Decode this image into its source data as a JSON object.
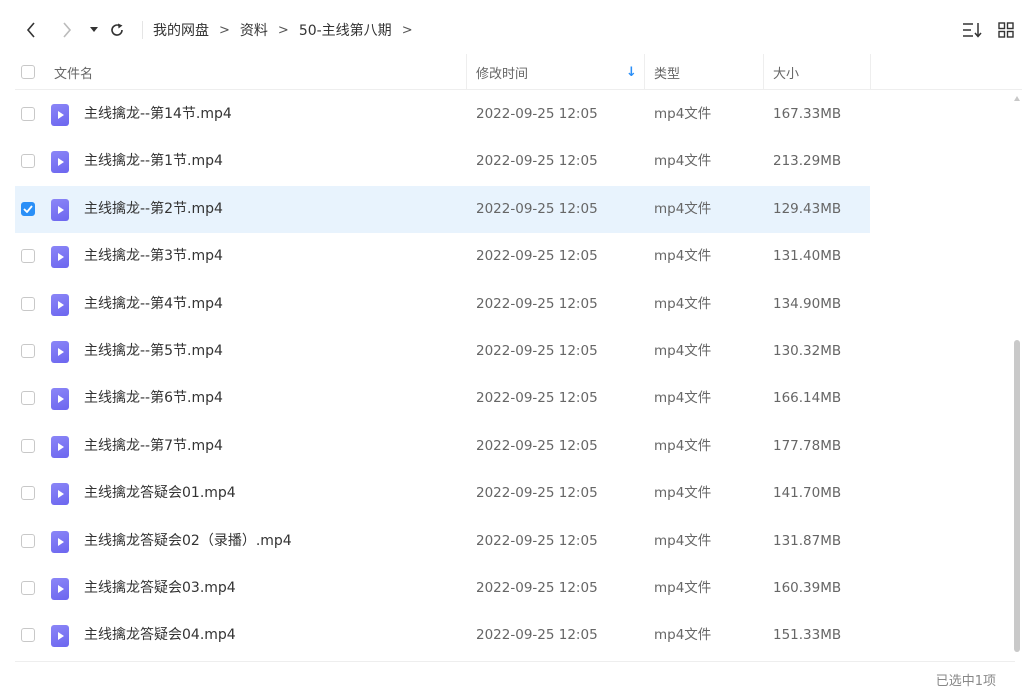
{
  "toolbar": {
    "back_icon": "chevron-left-icon",
    "forward_icon": "chevron-right-icon",
    "history_icon": "dropdown-triangle-icon",
    "refresh_icon": "refresh-icon",
    "sort_icon": "sort-list-icon",
    "grid_icon": "grid-view-icon"
  },
  "breadcrumb": {
    "items": [
      "我的网盘",
      "资料",
      "50-主线第八期"
    ],
    "separator": ">"
  },
  "header": {
    "name": "文件名",
    "modified": "修改时间",
    "type": "类型",
    "size": "大小",
    "sort_indicator": "↓"
  },
  "files": [
    {
      "name": "主线擒龙--第14节.mp4",
      "modified": "2022-09-25 12:05",
      "type": "mp4文件",
      "size": "167.33MB",
      "selected": false
    },
    {
      "name": "主线擒龙--第1节.mp4",
      "modified": "2022-09-25 12:05",
      "type": "mp4文件",
      "size": "213.29MB",
      "selected": false
    },
    {
      "name": "主线擒龙--第2节.mp4",
      "modified": "2022-09-25 12:05",
      "type": "mp4文件",
      "size": "129.43MB",
      "selected": true
    },
    {
      "name": "主线擒龙--第3节.mp4",
      "modified": "2022-09-25 12:05",
      "type": "mp4文件",
      "size": "131.40MB",
      "selected": false
    },
    {
      "name": "主线擒龙--第4节.mp4",
      "modified": "2022-09-25 12:05",
      "type": "mp4文件",
      "size": "134.90MB",
      "selected": false
    },
    {
      "name": "主线擒龙--第5节.mp4",
      "modified": "2022-09-25 12:05",
      "type": "mp4文件",
      "size": "130.32MB",
      "selected": false
    },
    {
      "name": "主线擒龙--第6节.mp4",
      "modified": "2022-09-25 12:05",
      "type": "mp4文件",
      "size": "166.14MB",
      "selected": false
    },
    {
      "name": "主线擒龙--第7节.mp4",
      "modified": "2022-09-25 12:05",
      "type": "mp4文件",
      "size": "177.78MB",
      "selected": false
    },
    {
      "name": "主线擒龙答疑会01.mp4",
      "modified": "2022-09-25 12:05",
      "type": "mp4文件",
      "size": "141.70MB",
      "selected": false
    },
    {
      "name": "主线擒龙答疑会02（录播）.mp4",
      "modified": "2022-09-25 12:05",
      "type": "mp4文件",
      "size": "131.87MB",
      "selected": false
    },
    {
      "name": "主线擒龙答疑会03.mp4",
      "modified": "2022-09-25 12:05",
      "type": "mp4文件",
      "size": "160.39MB",
      "selected": false
    },
    {
      "name": "主线擒龙答疑会04.mp4",
      "modified": "2022-09-25 12:05",
      "type": "mp4文件",
      "size": "151.33MB",
      "selected": false
    }
  ],
  "file_icon": "video-file-icon",
  "status": {
    "selection_text": "已选中1项"
  },
  "colors": {
    "accent": "#2a8ff7",
    "selected_row": "#e8f3fd",
    "file_icon": "#7b76f3"
  }
}
